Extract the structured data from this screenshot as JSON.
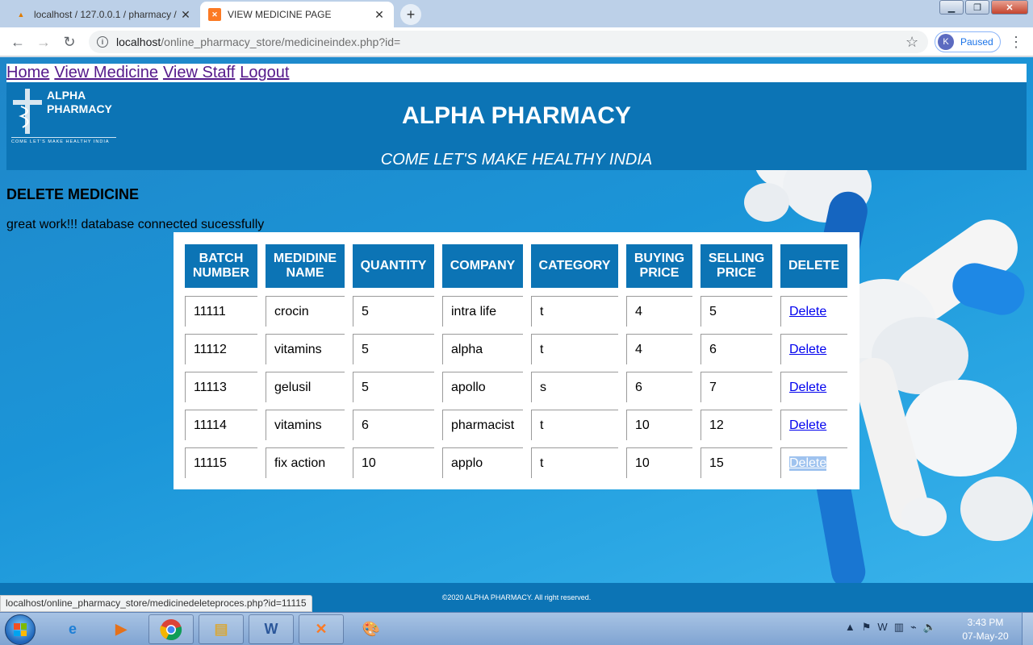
{
  "browser": {
    "tabs": [
      {
        "title": "localhost / 127.0.0.1 / pharmacy /",
        "icon": "phpmyadmin-icon"
      },
      {
        "title": "VIEW MEDICINE PAGE",
        "icon": "xampp-icon"
      }
    ],
    "url_host": "localhost",
    "url_path": "/online_pharmacy_store/medicineindex.php?id=",
    "profile_initial": "K",
    "profile_status": "Paused"
  },
  "nav": {
    "home": "Home",
    "view_medicine": "View Medicine",
    "view_staff": "View Staff",
    "logout": "Logout"
  },
  "header": {
    "logo_line1": "ALPHA",
    "logo_line2": "PHARMACY",
    "logo_tagline": "COME LET'S MAKE HEALTHY INDIA",
    "title": "ALPHA PHARMACY",
    "tagline": "COME LET'S MAKE HEALTHY INDIA"
  },
  "page": {
    "heading": "DELETE MEDICINE",
    "db_status": "great work!!! database connected sucessfully"
  },
  "table": {
    "headers": [
      "BATCH NUMBER",
      "MEDIDINE NAME",
      "QUANTITY",
      "COMPANY",
      "CATEGORY",
      "BUYING PRICE",
      "SELLING PRICE",
      "DELETE"
    ],
    "rows": [
      [
        "11111",
        "crocin",
        "5",
        "intra life",
        "t",
        "4",
        "5",
        "Delete"
      ],
      [
        "11112",
        "vitamins",
        "5",
        "alpha",
        "t",
        "4",
        "6",
        "Delete"
      ],
      [
        "11113",
        "gelusil",
        "5",
        "apollo",
        "s",
        "6",
        "7",
        "Delete"
      ],
      [
        "11114",
        "vitamins",
        "6",
        "pharmacist",
        "t",
        "10",
        "12",
        "Delete"
      ],
      [
        "11115",
        "fix action",
        "10",
        "applo",
        "t",
        "10",
        "15",
        "Delete"
      ]
    ]
  },
  "footer": {
    "text": "©2020 ALPHA PHARMACY. All right reserved."
  },
  "status_bar": {
    "link_preview": "localhost/online_pharmacy_store/medicinedeleteproces.php?id=11115"
  },
  "taskbar": {
    "apps": [
      "internet-explorer-icon",
      "media-player-icon",
      "chrome-icon",
      "file-explorer-icon",
      "word-icon",
      "xampp-icon",
      "paint-icon"
    ],
    "clock_time": "3:43 PM",
    "clock_date": "07-May-20"
  },
  "colors": {
    "header_blue": "#0c74b5",
    "link_visited": "#551a8b",
    "link": "#0000ee"
  }
}
